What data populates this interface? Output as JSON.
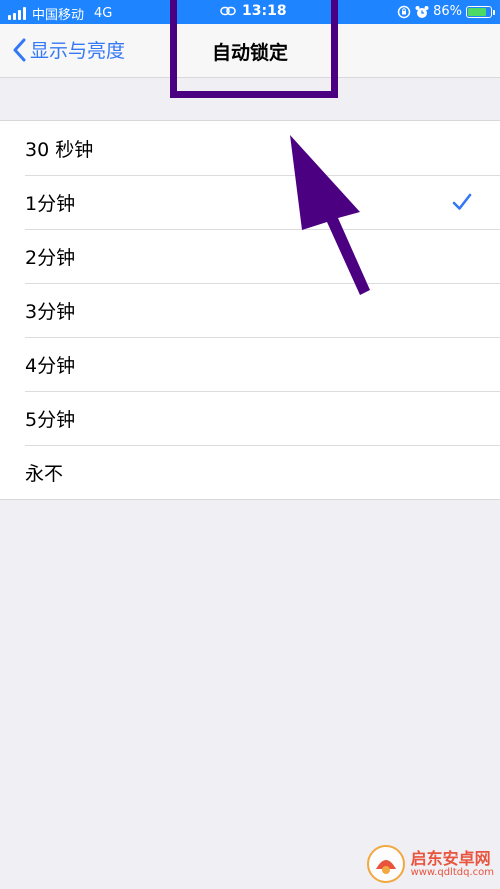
{
  "status_bar": {
    "carrier": "中国移动",
    "network": "4G",
    "time": "13:18",
    "battery": "86%",
    "battery_level": 0.86,
    "bg_color": "#1e84ff"
  },
  "nav": {
    "back_label": "显示与亮度",
    "title": "自动锁定",
    "accent_color": "#3478f6"
  },
  "options": [
    {
      "label": "30 秒钟",
      "selected": false
    },
    {
      "label": "1分钟",
      "selected": true
    },
    {
      "label": "2分钟",
      "selected": false
    },
    {
      "label": "3分钟",
      "selected": false
    },
    {
      "label": "4分钟",
      "selected": false
    },
    {
      "label": "5分钟",
      "selected": false
    },
    {
      "label": "永不",
      "selected": false
    }
  ],
  "annotation": {
    "color": "#4b0082"
  },
  "watermark": {
    "brand": "启东安卓网",
    "url": "www.qdltdq.com"
  },
  "icons": [
    "signal-icon",
    "link-icon",
    "lock-rotation-icon",
    "alarm-icon",
    "battery-icon",
    "chevron-left-icon",
    "checkmark-icon",
    "arrow-annotation-icon",
    "watermark-logo-icon"
  ]
}
